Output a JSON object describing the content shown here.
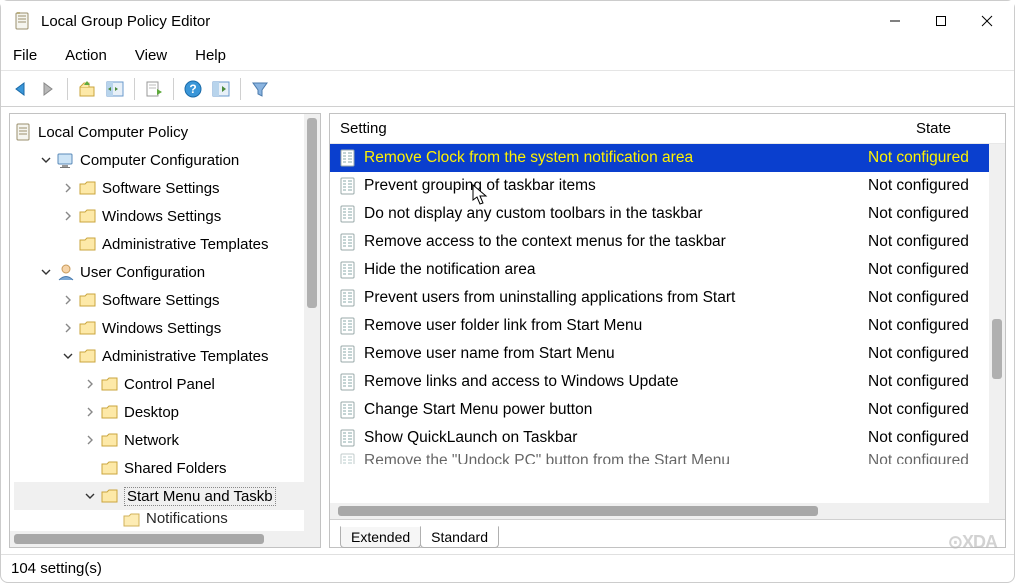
{
  "window": {
    "title": "Local Group Policy Editor"
  },
  "menubar": {
    "items": [
      "File",
      "Action",
      "View",
      "Help"
    ]
  },
  "tree": {
    "root": "Local Computer Policy",
    "nodes": [
      {
        "label": "Computer Configuration",
        "depth": 1,
        "chev": "down",
        "icon": "computer"
      },
      {
        "label": "Software Settings",
        "depth": 2,
        "chev": "right",
        "icon": "folder"
      },
      {
        "label": "Windows Settings",
        "depth": 2,
        "chev": "right",
        "icon": "folder"
      },
      {
        "label": "Administrative Templates",
        "depth": 2,
        "chev": "none",
        "icon": "folder"
      },
      {
        "label": "User Configuration",
        "depth": 1,
        "chev": "down",
        "icon": "user"
      },
      {
        "label": "Software Settings",
        "depth": 2,
        "chev": "right",
        "icon": "folder"
      },
      {
        "label": "Windows Settings",
        "depth": 2,
        "chev": "right",
        "icon": "folder"
      },
      {
        "label": "Administrative Templates",
        "depth": 2,
        "chev": "down",
        "icon": "folder"
      },
      {
        "label": "Control Panel",
        "depth": 3,
        "chev": "right",
        "icon": "folder"
      },
      {
        "label": "Desktop",
        "depth": 3,
        "chev": "right",
        "icon": "folder"
      },
      {
        "label": "Network",
        "depth": 3,
        "chev": "right",
        "icon": "folder"
      },
      {
        "label": "Shared Folders",
        "depth": 3,
        "chev": "none",
        "icon": "folder"
      },
      {
        "label": "Start Menu and Taskb",
        "depth": 3,
        "chev": "down",
        "icon": "folder",
        "selected": true
      },
      {
        "label": "Notifications",
        "depth": 4,
        "chev": "none",
        "icon": "folder",
        "cut": true
      }
    ]
  },
  "list": {
    "columns": {
      "setting": "Setting",
      "state": "State"
    },
    "rows": [
      {
        "name": "Remove Clock from the system notification area",
        "state": "Not configured",
        "selected": true
      },
      {
        "name": "Prevent grouping of taskbar items",
        "state": "Not configured"
      },
      {
        "name": "Do not display any custom toolbars in the taskbar",
        "state": "Not configured"
      },
      {
        "name": "Remove access to the context menus for the taskbar",
        "state": "Not configured"
      },
      {
        "name": "Hide the notification area",
        "state": "Not configured"
      },
      {
        "name": "Prevent users from uninstalling applications from Start",
        "state": "Not configured"
      },
      {
        "name": "Remove user folder link from Start Menu",
        "state": "Not configured"
      },
      {
        "name": "Remove user name from Start Menu",
        "state": "Not configured"
      },
      {
        "name": "Remove links and access to Windows Update",
        "state": "Not configured"
      },
      {
        "name": "Change Start Menu power button",
        "state": "Not configured"
      },
      {
        "name": "Show QuickLaunch on Taskbar",
        "state": "Not configured"
      },
      {
        "name": "Remove the \"Undock PC\" button from the Start Menu",
        "state": "Not configured",
        "cut": true
      }
    ]
  },
  "tabs": {
    "extended": "Extended",
    "standard": "Standard"
  },
  "status": {
    "text": "104 setting(s)"
  },
  "watermark": "⊙XDA"
}
